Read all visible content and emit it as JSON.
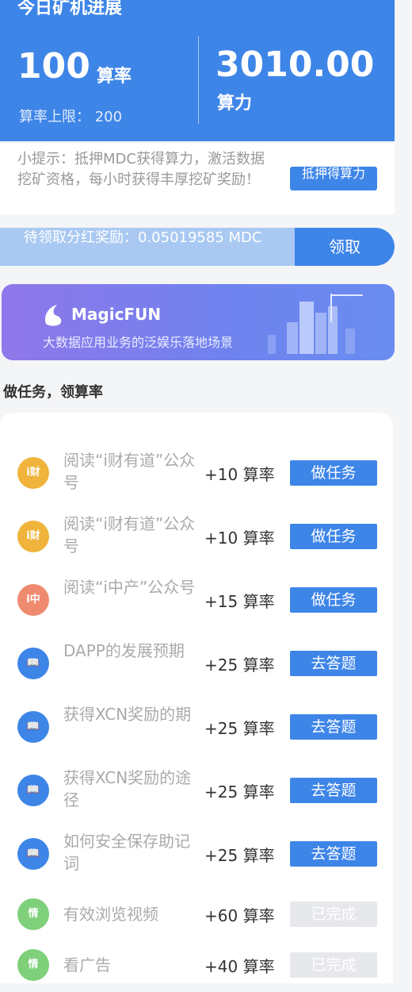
{
  "header": {
    "title": "今日矿机进展",
    "left_value": "100",
    "left_unit": "算率",
    "limit_label": "算率上限：",
    "limit_value": "200",
    "right_value": "3010.00",
    "right_unit": "算力"
  },
  "tip": {
    "text": "小提示：抵押MDC获得算力，激活数据挖矿资格，每小时获得丰厚挖矿奖励！",
    "button": "抵押得算力"
  },
  "claim": {
    "text": "待领取分红奖励：0.05019585 MDC",
    "button": "领取"
  },
  "banner": {
    "brand": "MagicFUN",
    "slogan": "大数据应用业务的泛娱乐落地场景"
  },
  "tasks_title": "做任务，领算率",
  "tasks": [
    {
      "icon": "i财",
      "color": "#f0b43c",
      "name": "阅读“i财有道”公众号",
      "reward": "+10 算率",
      "button": "做任务",
      "done": false
    },
    {
      "icon": "i财",
      "color": "#f0b43c",
      "name": "阅读“i财有道”公众号",
      "reward": "+10 算率",
      "button": "做任务",
      "done": false
    },
    {
      "icon": "i中",
      "color": "#f08a6e",
      "name": "阅读“i中产”公众号",
      "reward": "+15 算率",
      "button": "做任务",
      "done": false
    },
    {
      "icon": "📖",
      "color": "#3e85e8",
      "name": "DAPP的发展预期",
      "reward": "+25 算率",
      "button": "去答题",
      "done": false
    },
    {
      "icon": "📖",
      "color": "#3e85e8",
      "name": "获得XCN奖励的期",
      "reward": "+25 算率",
      "button": "去答题",
      "done": false
    },
    {
      "icon": "📖",
      "color": "#3e85e8",
      "name": "获得XCN奖励的途径",
      "reward": "+25 算率",
      "button": "去答题",
      "done": false
    },
    {
      "icon": "📖",
      "color": "#3e85e8",
      "name": "如何安全保存助记词",
      "reward": "+25 算率",
      "button": "去答题",
      "done": false
    },
    {
      "icon": "情",
      "color": "#7fd07a",
      "name": "有效浏览视频",
      "reward": "+60 算率",
      "button": "已完成",
      "done": true
    },
    {
      "icon": "情",
      "color": "#7fd07a",
      "name": "看广告",
      "reward": "+40 算率",
      "button": "已完成",
      "done": true
    }
  ]
}
